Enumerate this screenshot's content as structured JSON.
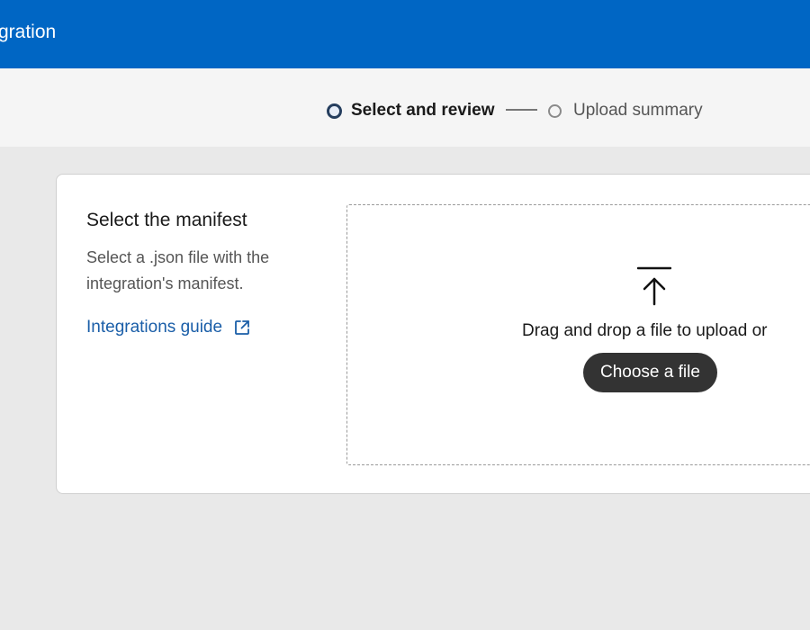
{
  "header": {
    "title": "gration"
  },
  "steps": [
    {
      "label": "Select and review",
      "state": "active"
    },
    {
      "label": "Upload summary",
      "state": "inactive"
    }
  ],
  "panel": {
    "title": "Select the manifest",
    "description": "Select a .json file with the integration's manifest.",
    "guide_link": "Integrations guide",
    "guide_icon": "external-link-icon"
  },
  "dropzone": {
    "icon": "upload-icon",
    "text": "Drag and drop a file to upload or",
    "button_label": "Choose a file"
  },
  "colors": {
    "header_bg": "#0066c4",
    "link": "#1a5ea8",
    "button_bg": "#333333",
    "page_bg": "#e9e9e9"
  }
}
